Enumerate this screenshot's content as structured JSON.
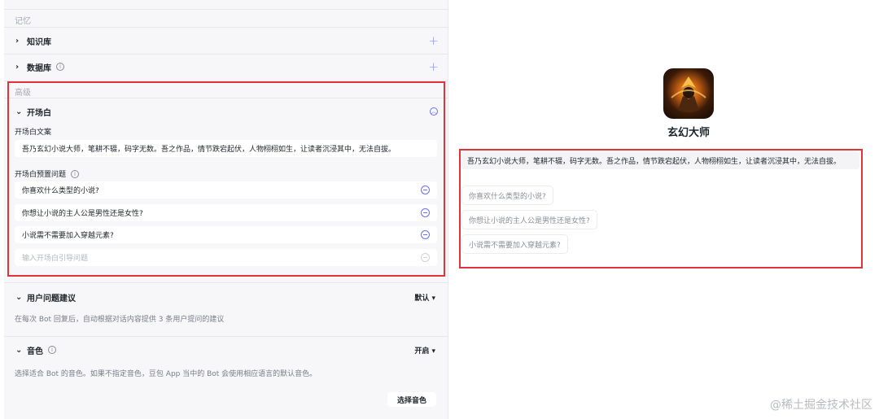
{
  "left": {
    "memory_section": "记忆",
    "knowledge": {
      "label": "知识库"
    },
    "database": {
      "label": "数据库"
    },
    "advanced_section": "高级",
    "opening": {
      "label": "开场白",
      "text_label": "开场白文案",
      "text_value": "吾乃玄幻小说大师，笔耕不辍，码字无数。吾之作品，情节跌宕起伏，人物栩栩如生，让读者沉浸其中，无法自拔。",
      "questions_label": "开场白预置问题",
      "questions": [
        "你喜欢什么类型的小说?",
        "你想让小说的主人公是男性还是女性?",
        "小说需不需要加入穿越元素?"
      ],
      "question_placeholder": "输入开场白引导问题"
    },
    "user_suggestion": {
      "label": "用户问题建议",
      "mode": "默认",
      "desc": "在每次 Bot 回复后，自动根据对话内容提供 3 条用户提问的建议"
    },
    "voice": {
      "label": "音色",
      "mode": "开启",
      "desc": "选择适合 Bot 的音色。如果不指定音色，豆包 App 当中的 Bot 会使用相应语言的默认音色。",
      "select_button": "选择音色"
    }
  },
  "preview": {
    "bot_name": "玄幻大师",
    "prologue": "吾乃玄幻小说大师，笔耕不辍，码字无数。吾之作品，情节跌宕起伏，人物栩栩如生，让读者沉浸其中，无法自拔。",
    "suggestions": [
      "你喜欢什么类型的小说?",
      "你想让小说的主人公是男性还是女性?",
      "小说需不需要加入穿越元素?"
    ]
  },
  "watermark": "@稀土掘金技术社区",
  "colors": {
    "highlight": "#e0333a",
    "accent": "#6a6ff5"
  }
}
